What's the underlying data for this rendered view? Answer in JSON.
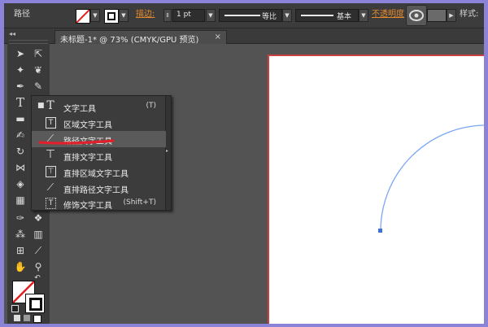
{
  "control_bar": {
    "selection_label": "路径",
    "stroke_label": "描边:",
    "stroke_weight": "1 pt",
    "profile_label": "等比",
    "brush_label": "基本",
    "opacity_label": "不透明度",
    "style_label": "样式:"
  },
  "document_tab": {
    "title": "未标题-1* @ 73% (CMYK/GPU 预览)",
    "close": "×"
  },
  "flyout": {
    "items": [
      {
        "label": "文字工具",
        "shortcut": "(T)",
        "icon": "T",
        "active": true
      },
      {
        "label": "区域文字工具",
        "shortcut": "",
        "icon": "T"
      },
      {
        "label": "路径文字工具",
        "shortcut": "",
        "icon": "⟋",
        "highlighted": true
      },
      {
        "label": "直排文字工具",
        "shortcut": "",
        "icon": "⊤"
      },
      {
        "label": "直排区域文字工具",
        "shortcut": "",
        "icon": "⊤"
      },
      {
        "label": "直排路径文字工具",
        "shortcut": "",
        "icon": "⟋"
      },
      {
        "label": "修饰文字工具",
        "shortcut": "(Shift+T)",
        "icon": "T"
      }
    ]
  },
  "colors": {
    "panel": "#3a3a3a",
    "workspace": "#535353",
    "artboard_border": "#c94040",
    "path_stroke": "#7aa6f5",
    "underline": "#e0202a",
    "frame": "#8a83d8"
  }
}
